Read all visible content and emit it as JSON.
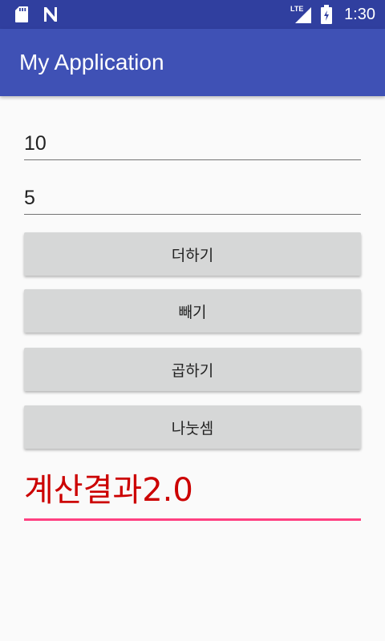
{
  "status_bar": {
    "left_icons": [
      "sd-card-icon",
      "n-notification-icon"
    ],
    "network_label": "LTE",
    "right_icons": [
      "signal-icon",
      "battery-icon"
    ],
    "time": "1:30"
  },
  "app_bar": {
    "title": "My Application"
  },
  "inputs": {
    "first_value": "10",
    "second_value": "5"
  },
  "buttons": {
    "add": "더하기",
    "subtract": "빼기",
    "multiply": "곱하기",
    "divide": "나눗셈"
  },
  "result": {
    "text": "계산결과2.0",
    "color": "#cc0000",
    "underline_color": "#ff4081"
  },
  "colors": {
    "status_bar": "#303f9f",
    "app_bar": "#3f51b5",
    "background": "#fafafa",
    "button": "#d6d7d7"
  }
}
